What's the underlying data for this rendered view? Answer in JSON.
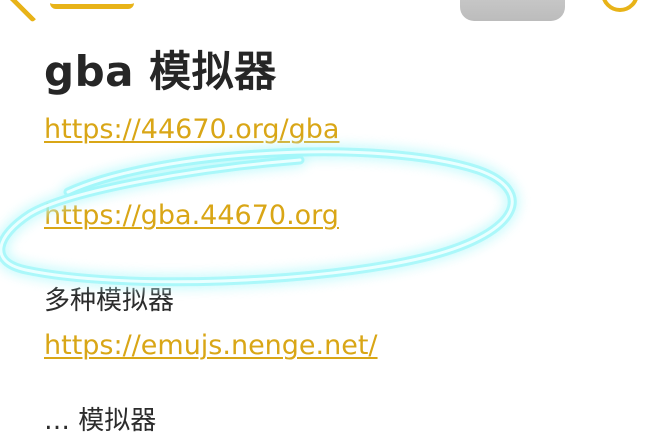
{
  "note": {
    "title": "gba 模拟器",
    "links": [
      "https://44670.org/gba",
      "https://gba.44670.org"
    ],
    "section_label": "多种模拟器",
    "section_link": "https://emujs.nenge.net/",
    "cutoff_text": "…  模拟器"
  },
  "colors": {
    "accent": "#d9a616",
    "annotation": "#3fe6ee",
    "text": "#262626"
  },
  "icons": {
    "back": "chevron-left-icon",
    "more": "more-circle-icon"
  }
}
